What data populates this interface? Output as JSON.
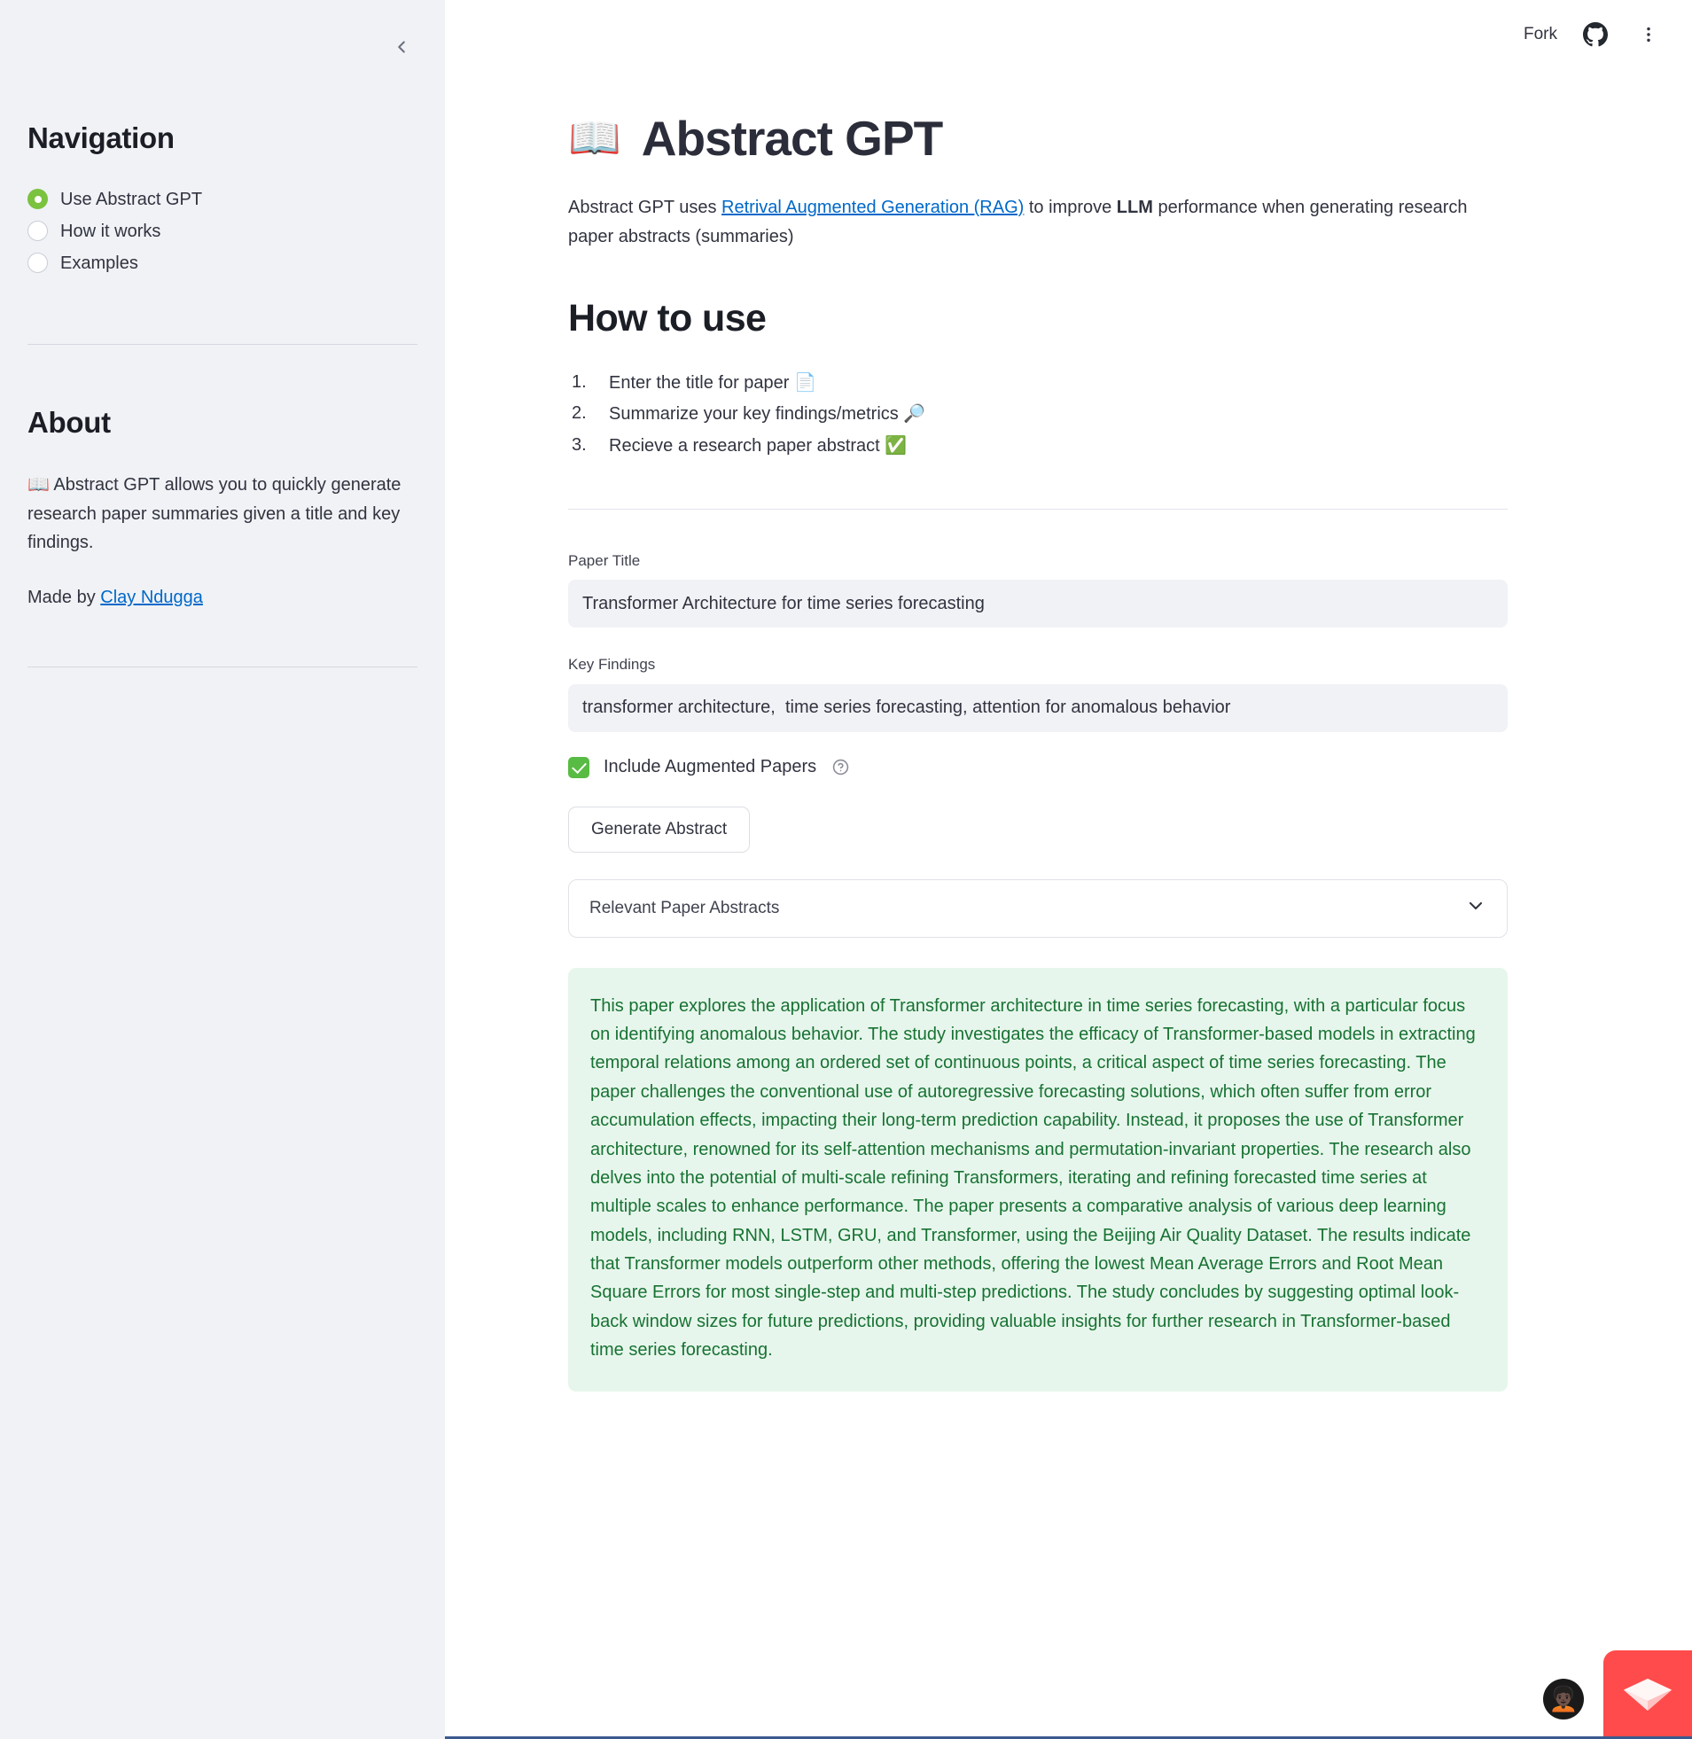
{
  "sidebar": {
    "collapse_icon": "chevron-left-icon",
    "navigation": {
      "heading": "Navigation",
      "items": [
        {
          "label": "Use Abstract GPT",
          "selected": true
        },
        {
          "label": "How it works",
          "selected": false
        },
        {
          "label": "Examples",
          "selected": false
        }
      ]
    },
    "about": {
      "heading": "About",
      "emoji": "📖",
      "text": "Abstract GPT allows you to quickly generate research paper summaries given a title and key findings.",
      "made_by_prefix": "Made by ",
      "made_by_link": "Clay Ndugga"
    }
  },
  "topbar": {
    "fork_label": "Fork",
    "github_icon": "github-icon",
    "menu_icon": "more-vertical-icon"
  },
  "main": {
    "title_emoji": "📖",
    "title": "Abstract GPT",
    "lede": {
      "part1": "Abstract GPT uses ",
      "link": "Retrival Augmented Generation (RAG)",
      "part2": " to improve ",
      "bold": "LLM",
      "part3": " performance when generating research paper abstracts (summaries)"
    },
    "howto": {
      "heading": "How to use",
      "steps": [
        {
          "text": "Enter the title for paper ",
          "emoji": "📄"
        },
        {
          "text": "Summarize your key findings/metrics ",
          "emoji": "🔎"
        },
        {
          "text": "Recieve a research paper abstract ",
          "emoji": "✅"
        }
      ]
    },
    "form": {
      "paper_title_label": "Paper Title",
      "paper_title_value": "Transformer Architecture for time series forecasting",
      "paper_title_placeholder": "Paper Title",
      "key_findings_label": "Key Findings",
      "key_findings_value": "transformer architecture,  time series forecasting, attention for anomalous behavior",
      "key_findings_placeholder": "Key Findings",
      "include_augmented_label": "Include Augmented Papers",
      "include_augmented_checked": true,
      "help_icon": "question-circle-icon",
      "generate_button": "Generate Abstract"
    },
    "expander": {
      "label": "Relevant Paper Abstracts",
      "icon": "chevron-down-icon",
      "expanded": false
    },
    "result": "This paper explores the application of Transformer architecture in time series forecasting, with a particular focus on identifying anomalous behavior. The study investigates the efficacy of Transformer-based models in extracting temporal relations among an ordered set of continuous points, a critical aspect of time series forecasting. The paper challenges the conventional use of autoregressive forecasting solutions, which often suffer from error accumulation effects, impacting their long-term prediction capability. Instead, it proposes the use of Transformer architecture, renowned for its self-attention mechanisms and permutation-invariant properties. The research also delves into the potential of multi-scale refining Transformers, iterating and refining forecasted time series at multiple scales to enhance performance. The paper presents a comparative analysis of various deep learning models, including RNN, LSTM, GRU, and Transformer, using the Beijing Air Quality Dataset. The results indicate that Transformer models outperform other methods, offering the lowest Mean Average Errors and Root Mean Square Errors for most single-step and multi-step predictions. The study concludes by suggesting optimal look-back window sizes for future predictions, providing valuable insights for further research in Transformer-based time series forecasting."
  },
  "floating": {
    "avatar_icon": "user-avatar",
    "avatar_emoji": "🧑🏿‍🦱",
    "cloud_badge_icon": "streamlit-cloud-badge"
  },
  "colors": {
    "sidebar_bg": "#F0F2F6",
    "accent_green": "#7BC23F",
    "checkbox_green": "#58BB43",
    "link_blue": "#0068C9",
    "success_bg": "#E7F6EC",
    "success_text": "#177233",
    "badge_red": "#FF4B4B"
  }
}
